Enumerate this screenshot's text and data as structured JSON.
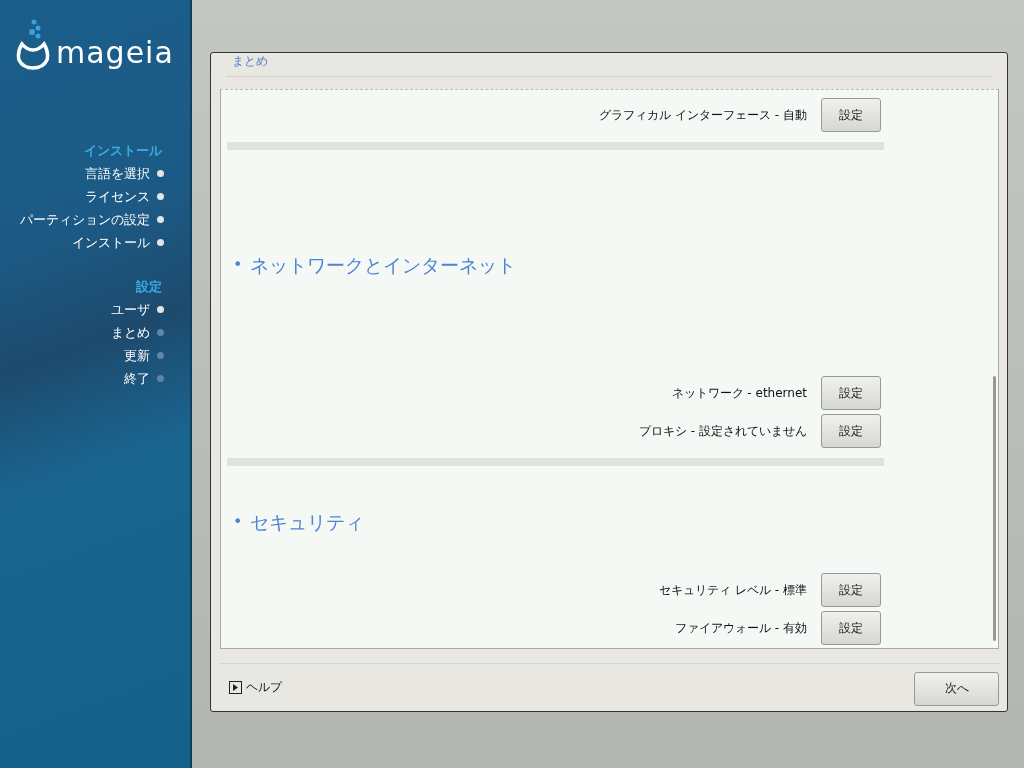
{
  "logo": {
    "text": "mageia"
  },
  "sidebar": {
    "groups": [
      {
        "title": "インストール",
        "items": [
          {
            "label": "言語を選択",
            "done": true
          },
          {
            "label": "ライセンス",
            "done": true
          },
          {
            "label": "パーティションの設定",
            "done": true
          },
          {
            "label": "インストール",
            "done": true
          }
        ]
      },
      {
        "title": "設定",
        "items": [
          {
            "label": "ユーザ",
            "done": true
          },
          {
            "label": "まとめ",
            "done": false
          },
          {
            "label": "更新",
            "done": false
          },
          {
            "label": "終了",
            "done": false
          }
        ]
      }
    ]
  },
  "dialog": {
    "title": "まとめ",
    "sections": [
      {
        "items": [
          {
            "label": "グラフィカル インターフェース - 自動",
            "button": "設定"
          }
        ]
      },
      {
        "bullet": "•",
        "heading": "ネットワークとインターネット",
        "items": [
          {
            "label": "ネットワーク - ethernet",
            "button": "設定"
          },
          {
            "label": "プロキシ - 設定されていません",
            "button": "設定"
          }
        ]
      },
      {
        "bullet": "•",
        "heading": "セキュリティ",
        "items": [
          {
            "label": "セキュリティ レベル - 標準",
            "button": "設定"
          },
          {
            "label": "ファイアウォール - 有効",
            "button": "設定"
          }
        ]
      }
    ],
    "help": "ヘルプ",
    "next": "次へ"
  }
}
